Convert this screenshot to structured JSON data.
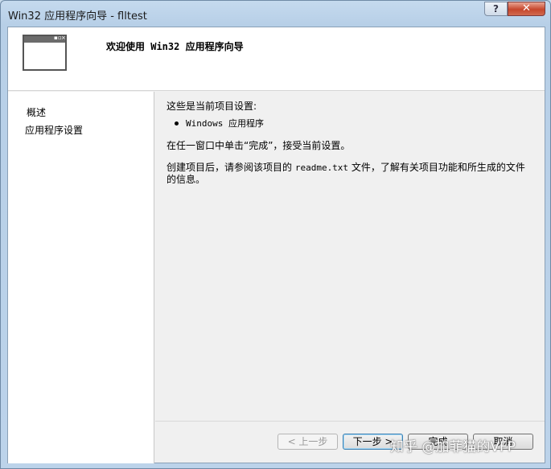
{
  "window": {
    "title": "Win32 应用程序向导 - flltest",
    "help_label": "?",
    "close_label": "✕"
  },
  "banner": {
    "title": "欢迎使用 Win32 应用程序向导",
    "icon": "window-icon"
  },
  "nav": {
    "items": [
      {
        "label": "概述"
      },
      {
        "label": "应用程序设置"
      }
    ]
  },
  "content": {
    "heading": "这些是当前项目设置:",
    "bullet": "Windows 应用程序",
    "instruction": "在任一窗口中单击“完成”，接受当前设置。",
    "readme_prefix": "创建项目后，请参阅该项目的 ",
    "readme_file": "readme.txt",
    "readme_suffix": " 文件，了解有关项目功能和所生成的文件的信息。"
  },
  "buttons": {
    "prev": "< 上一步",
    "next": "下一步 >",
    "finish": "完成",
    "cancel": "取消"
  },
  "watermark": "知乎 @加菲猫的VFP"
}
